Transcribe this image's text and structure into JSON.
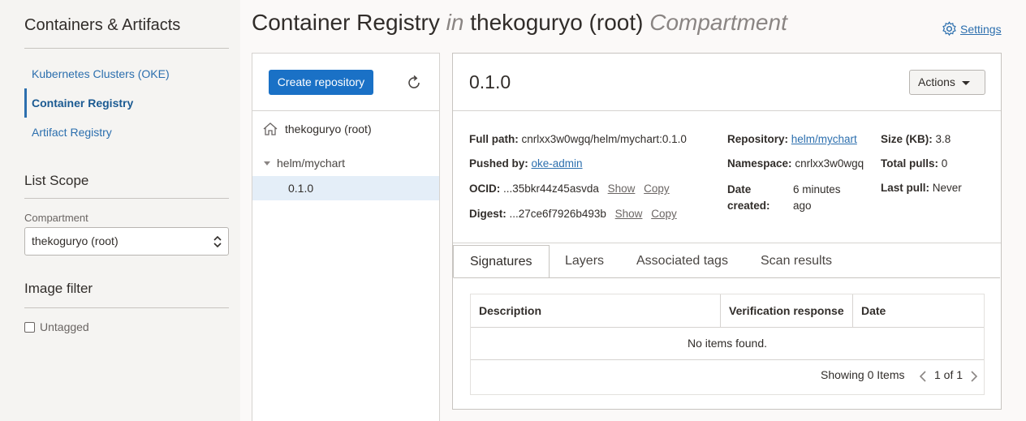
{
  "sidebar": {
    "title": "Containers & Artifacts",
    "items": [
      {
        "label": "Kubernetes Clusters (OKE)"
      },
      {
        "label": "Container Registry"
      },
      {
        "label": "Artifact Registry"
      }
    ],
    "list_scope": {
      "title": "List Scope",
      "compartment_label": "Compartment",
      "compartment_value": "thekoguryo (root)"
    },
    "image_filter": {
      "title": "Image filter",
      "untagged_label": "Untagged",
      "untagged_checked": false
    }
  },
  "header": {
    "title_main": "Container Registry",
    "title_in": "in",
    "title_compartment": "thekoguryo (root)",
    "title_suffix": "Compartment",
    "settings_label": "Settings"
  },
  "tree": {
    "create_button": "Create repository",
    "root": "thekoguryo (root)",
    "repo": "helm/mychart",
    "version": "0.1.0"
  },
  "detail": {
    "title": "0.1.0",
    "actions_label": "Actions",
    "full_path": {
      "label": "Full path:",
      "value": "cnrlxx3w0wgq/helm/mychart:0.1.0"
    },
    "pushed_by": {
      "label": "Pushed by:",
      "value": "oke-admin"
    },
    "ocid": {
      "label": "OCID:",
      "value": "...35bkr44z45asvda",
      "show": "Show",
      "copy": "Copy"
    },
    "digest": {
      "label": "Digest:",
      "value": "...27ce6f7926b493b",
      "show": "Show",
      "copy": "Copy"
    },
    "repository": {
      "label": "Repository:",
      "value": "helm/mychart"
    },
    "namespace": {
      "label": "Namespace:",
      "value": "cnrlxx3w0wgq"
    },
    "date_created": {
      "label_line1": "Date",
      "label_line2": "created:",
      "value_line1": "6 minutes",
      "value_line2": "ago"
    },
    "size": {
      "label": "Size (KB):",
      "value": "3.8"
    },
    "total_pulls": {
      "label": "Total pulls:",
      "value": "0"
    },
    "last_pull": {
      "label": "Last pull:",
      "value": "Never"
    },
    "tabs": [
      "Signatures",
      "Layers",
      "Associated tags",
      "Scan results"
    ],
    "table": {
      "columns": [
        "Description",
        "Verification response",
        "Date"
      ],
      "empty_text": "No items found.",
      "showing": "Showing 0 Items",
      "page": "1 of 1"
    }
  },
  "colors": {
    "primary": "#1a71c6",
    "link": "#2c6fae",
    "selected_row": "#e4eef8"
  }
}
